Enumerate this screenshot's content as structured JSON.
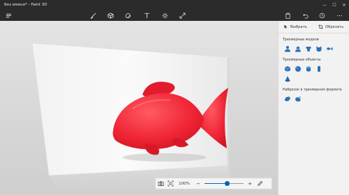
{
  "window": {
    "title": "Без имени* - Paint 3D",
    "minimize": "—",
    "maximize": "☐",
    "close": "✕"
  },
  "toolbar": {
    "menu_icon": "menu-icon",
    "tools": [
      "brush-icon",
      "3d-shapes-icon",
      "stickers-icon",
      "text-icon",
      "effects-icon",
      "canvas-icon"
    ],
    "right": [
      "paste-icon",
      "undo-icon",
      "history-icon",
      "more-icon"
    ]
  },
  "panel": {
    "select_label": "Выбрать",
    "crop_label": "Обрезать",
    "sections": [
      {
        "title": "Трехмерные модели",
        "items": [
          "man-icon",
          "woman-icon",
          "dog-icon",
          "cat-icon",
          "fish-icon"
        ]
      },
      {
        "title": "Трехмерные объекты",
        "items": [
          "cube-icon",
          "sphere-icon",
          "cylinder-icon",
          "capsule-icon",
          "cone-icon"
        ]
      },
      {
        "title": "Набросок в трехмерном формате",
        "items": [
          "sharp-doodle-icon",
          "soft-doodle-icon"
        ]
      }
    ]
  },
  "zoom": {
    "percent": "100%",
    "minus": "−",
    "plus": "+",
    "level": 0.58
  },
  "colors": {
    "accent": "#0063b1",
    "fish": "#f02a3a",
    "titlebar": "#2b2b2b",
    "panel_icon": "#2a71b8"
  }
}
